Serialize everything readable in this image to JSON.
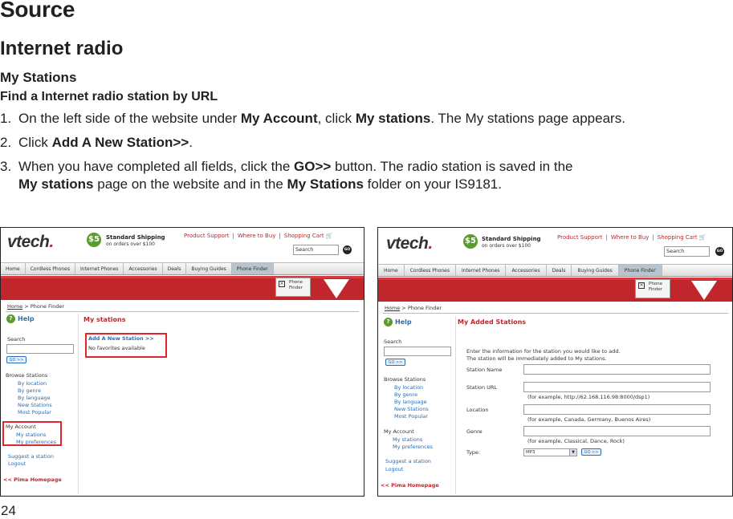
{
  "headings": {
    "source": "Source",
    "internet_radio": "Internet radio",
    "my_stations": "My Stations",
    "find": "Find a Internet radio station by URL"
  },
  "steps": [
    {
      "num": "1.",
      "pre": "On the left side of the website under ",
      "b1": "My Account",
      "mid": ", click ",
      "b2": "My stations",
      "post": ". The My stations page appears."
    },
    {
      "num": "2.",
      "pre": "Click ",
      "b1": "Add A New Station>>",
      "post": "."
    },
    {
      "num": "3.",
      "pre": "When you have completed all fields, click the ",
      "b1": "GO>>",
      "mid": " button. The radio station is saved in the ",
      "b2": "My stations",
      "mid2": " page on the website and in the ",
      "b3": "My Stations",
      "post": " folder on your IS9181."
    }
  ],
  "page_number": "24",
  "site": {
    "logo": "vtech",
    "shipping_badge": "$5",
    "shipping_title": "Standard Shipping",
    "shipping_sub": "on orders over $100",
    "top_links": [
      "Product Support",
      "Where to Buy",
      "Shopping Cart"
    ],
    "search_placeholder": "Search",
    "go_label": "GO",
    "nav": [
      "Home",
      "Cordless Phones",
      "Internet Phones",
      "Accessories",
      "Deals",
      "Buying Guides",
      "Phone Finder"
    ],
    "finder_box": [
      "Phone",
      "Finder"
    ],
    "breadcrumb": {
      "home": "Home",
      "sep": ">",
      "current": "Phone Finder"
    },
    "help": "Help",
    "sidebar": {
      "search": "Search",
      "go": "GO >>",
      "browse": "Browse Stations",
      "browse_items": [
        "By location",
        "By genre",
        "By language",
        "New Stations",
        "Most Popular"
      ],
      "account": "My Account",
      "account_items": [
        "My stations",
        "My preferences"
      ],
      "suggest": "Suggest a station",
      "logout": "Logout",
      "homepage": "<< Pima Homepage"
    }
  },
  "left_shot": {
    "title": "My stations",
    "add_link": "Add A New Station >>",
    "no_favorites": "No favorites available"
  },
  "right_shot": {
    "title": "My Added Stations",
    "intro1": "Enter the information for the station you would like to add.",
    "intro2": "The station will be immediately added to My stations.",
    "fields": [
      {
        "label": "Station Name",
        "hint": ""
      },
      {
        "label": "Station URL",
        "hint": "(for example, http://62.168.116.98:8000/dsp1)"
      },
      {
        "label": "Location",
        "hint": "(for example, Canada, Germany, Buenos Aires)"
      },
      {
        "label": "Genre",
        "hint": "(for example, Classical, Dance, Rock)"
      }
    ],
    "type_label": "Type:",
    "type_value": "MP3",
    "type_go": "GO >>"
  }
}
